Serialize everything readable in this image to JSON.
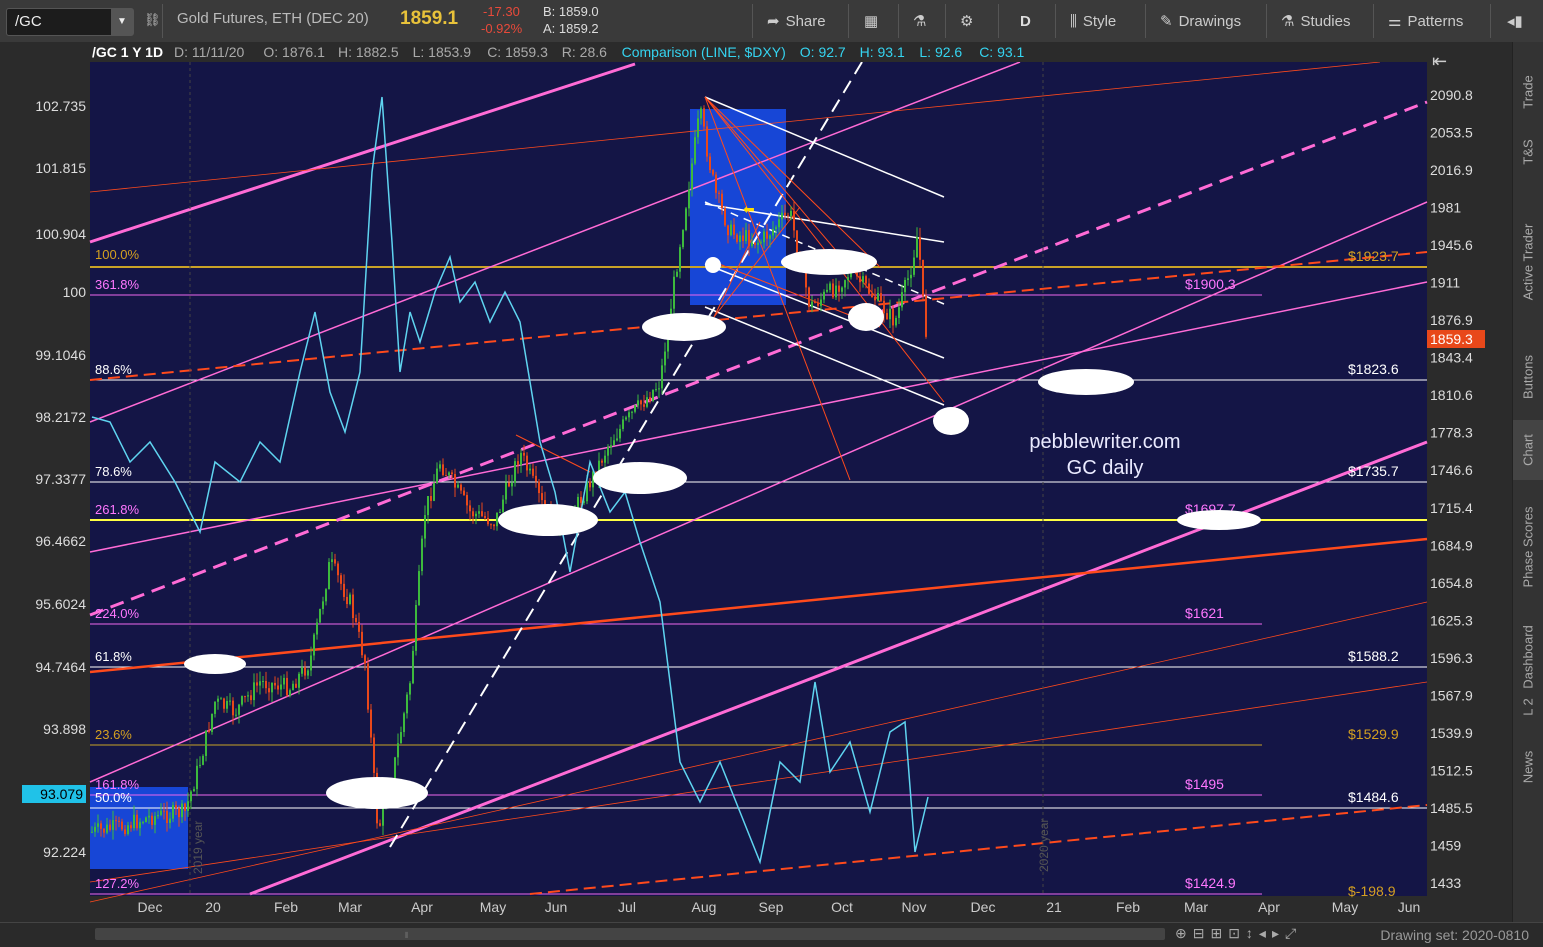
{
  "toolbar": {
    "symbol": "/GC",
    "instrument": "Gold Futures, ETH (DEC 20)",
    "last_price": "1859.1",
    "change": "-17.30",
    "change_pct": "-0.92%",
    "bid": "B: 1859.0",
    "ask": "A: 1859.2",
    "share": "Share",
    "period": "D",
    "style": "Style",
    "drawings": "Drawings",
    "studies": "Studies",
    "patterns": "Patterns"
  },
  "header": {
    "series": "/GC 1 Y 1D",
    "date": "D: 11/11/20",
    "open": "O: 1876.1",
    "high": "H: 1882.5",
    "low": "L: 1853.9",
    "close": "C: 1859.3",
    "range": "R: 28.6",
    "comparison": "Comparison (LINE, $DXY)",
    "c_open": "O: 92.7",
    "c_high": "H: 93.1",
    "c_low": "L: 92.6",
    "c_close": "C: 93.1"
  },
  "left_axis": [
    "102.735",
    "101.815",
    "100.904",
    "100",
    "99.1046",
    "98.2172",
    "97.3377",
    "96.4662",
    "95.6024",
    "94.7464",
    "93.898",
    "92.224"
  ],
  "left_axis_current": "93.079",
  "right_axis": [
    "2090.8",
    "2053.5",
    "2016.9",
    "1981",
    "1945.6",
    "1911",
    "1876.9",
    "1843.4",
    "1810.6",
    "1778.3",
    "1746.6",
    "1715.4",
    "1684.9",
    "1654.8",
    "1625.3",
    "1596.3",
    "1567.9",
    "1539.9",
    "1512.5",
    "1485.5",
    "1459",
    "1433"
  ],
  "right_axis_current": "1859.3",
  "x_axis": [
    "Dec",
    "20",
    "Feb",
    "Mar",
    "Apr",
    "May",
    "Jun",
    "Jul",
    "Aug",
    "Sep",
    "Oct",
    "Nov",
    "Dec",
    "21",
    "Feb",
    "Mar",
    "Apr",
    "May",
    "Jun"
  ],
  "year_labels": [
    "2019 year",
    "2020 year"
  ],
  "levels": [
    {
      "left": "100.0%",
      "right": "$1923.7",
      "lcolor": "#d4a020",
      "rcolor": "#d4a020",
      "line": "#c9a227"
    },
    {
      "left": "361.8%",
      "right": "$1900.3",
      "lcolor": "#ff77ff",
      "rcolor": "#ff77ff",
      "line": "#ee66ee"
    },
    {
      "left": "88.6%",
      "right": "$1823.6",
      "lcolor": "#ffffff",
      "rcolor": "#ffffff",
      "line": "#ffffff"
    },
    {
      "left": "78.6%",
      "right": "$1735.7",
      "lcolor": "#ffffff",
      "rcolor": "#ffffff",
      "line": "#ffffff"
    },
    {
      "left": "261.8%",
      "right": "$1697.7",
      "lcolor": "#ff77ff",
      "rcolor": "#ff77ff",
      "line": "#ffff44"
    },
    {
      "left": "224.0%",
      "right": "$1621",
      "lcolor": "#ff77ff",
      "rcolor": "#ff77ff",
      "line": "#ee66ee"
    },
    {
      "left": "61.8%",
      "right": "$1588.2",
      "lcolor": "#ffffff",
      "rcolor": "#ffffff",
      "line": "#ffffff"
    },
    {
      "left": "23.6%",
      "right": "$1529.9",
      "lcolor": "#d4a020",
      "rcolor": "#d4a020",
      "line": "#c9a227"
    },
    {
      "left": "161.8%",
      "right": "$1495",
      "lcolor": "#ff77ff",
      "rcolor": "#ff77ff",
      "line": "#ee66ee"
    },
    {
      "left": "50.0%",
      "right": "$1484.6",
      "lcolor": "#ffffff",
      "rcolor": "#ffffff",
      "line": "#ffffff"
    },
    {
      "left": "127.2%",
      "right": "$1424.9",
      "lcolor": "#ff77ff",
      "rcolor": "#ff77ff",
      "line": "#ee66ee"
    },
    {
      "left": "",
      "right": "$-198.9",
      "lcolor": "#d4a020",
      "rcolor": "#d4a020",
      "line": "#c9a227"
    }
  ],
  "watermark": [
    "pebblewriter.com",
    "GC daily"
  ],
  "rail": [
    "Trade",
    "T&S",
    "Active Trader",
    "Buttons",
    "Chart",
    "Phase Scores",
    "Dashboard",
    "L 2",
    "News"
  ],
  "footer": {
    "drawing_set": "Drawing set: 2020-0810"
  },
  "colors": {
    "chart_bg": "#141546",
    "price_up": "#3dba3d",
    "price_down": "#e8481a",
    "comparison": "#5fd4f0",
    "pink": "#ff6bd6",
    "orange": "#ff4a1c"
  }
}
